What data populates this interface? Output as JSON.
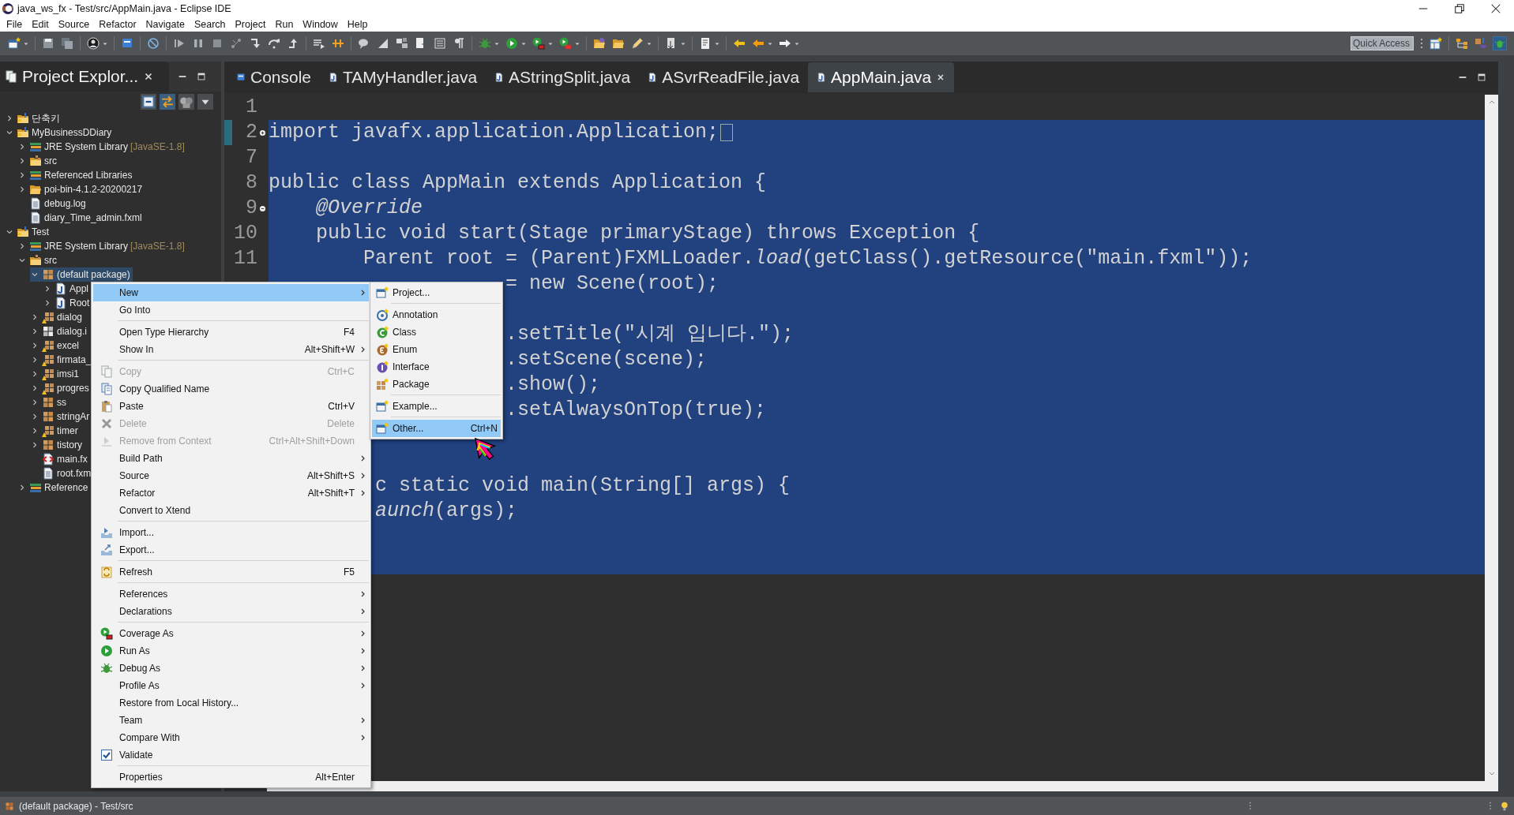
{
  "window": {
    "title": "java_ws_fx - Test/src/AppMain.java - Eclipse IDE"
  },
  "menu_bar": [
    "File",
    "Edit",
    "Source",
    "Refactor",
    "Navigate",
    "Search",
    "Project",
    "Run",
    "Window",
    "Help"
  ],
  "toolbar": {
    "quick_access": {
      "placeholder": "Quick Access"
    }
  },
  "project_explorer": {
    "title": "Project Explor...",
    "tree": [
      {
        "label": "단축키",
        "kind": "project",
        "expanded": false,
        "selected": false
      },
      {
        "label": "MyBusinessDDiary",
        "kind": "project",
        "expanded": true,
        "selected": false,
        "children": [
          {
            "label": "JRE System Library",
            "decoration": "[JavaSE-1.8]",
            "kind": "library",
            "expanded": false,
            "selected": false
          },
          {
            "label": "src",
            "kind": "source_folder",
            "expanded": false,
            "selected": false
          },
          {
            "label": "Referenced Libraries",
            "kind": "library",
            "expanded": false,
            "selected": false
          },
          {
            "label": "poi-bin-4.1.2-20200217",
            "kind": "folder",
            "expanded": false,
            "selected": false
          },
          {
            "label": "debug.log",
            "kind": "file",
            "selected": false
          },
          {
            "label": "diary_Time_admin.fxml",
            "kind": "file",
            "selected": false
          }
        ]
      },
      {
        "label": "Test",
        "kind": "project",
        "expanded": true,
        "selected": false,
        "children": [
          {
            "label": "JRE System Library",
            "decoration": "[JavaSE-1.8]",
            "kind": "library",
            "expanded": false,
            "selected": false
          },
          {
            "label": "src",
            "kind": "source_folder",
            "expanded": true,
            "selected": false,
            "children": [
              {
                "label": "(default package)",
                "kind": "package",
                "expanded": true,
                "selected": true,
                "children": [
                  {
                    "label": "Appl",
                    "kind": "java",
                    "expanded": false,
                    "selected": false
                  },
                  {
                    "label": "Root",
                    "kind": "java",
                    "expanded": false,
                    "selected": false
                  }
                ]
              },
              {
                "label": "dialog",
                "kind": "package_warning",
                "expanded": false,
                "selected": false
              },
              {
                "label": "dialog.i",
                "kind": "package_empty",
                "expanded": false,
                "selected": false
              },
              {
                "label": "excel",
                "kind": "package_warning",
                "expanded": false,
                "selected": false
              },
              {
                "label": "firmata_",
                "kind": "package_warning",
                "expanded": false,
                "selected": false
              },
              {
                "label": "imsi1",
                "kind": "package_warning",
                "expanded": false,
                "selected": false
              },
              {
                "label": "progres",
                "kind": "package_warning",
                "expanded": false,
                "selected": false
              },
              {
                "label": "ss",
                "kind": "package",
                "expanded": false,
                "selected": false
              },
              {
                "label": "stringAr",
                "kind": "package",
                "expanded": false,
                "selected": false
              },
              {
                "label": "timer",
                "kind": "package_warning",
                "expanded": false,
                "selected": false
              },
              {
                "label": "tistory",
                "kind": "package",
                "expanded": false,
                "selected": false
              },
              {
                "label": "main.fx",
                "kind": "fxml",
                "selected": false
              },
              {
                "label": "root.fxm",
                "kind": "file",
                "selected": false
              }
            ]
          },
          {
            "label": "Reference",
            "kind": "library",
            "expanded": false,
            "selected": false
          }
        ]
      }
    ]
  },
  "editor": {
    "tabs": [
      {
        "label": "Console",
        "selected": false
      },
      {
        "label": "TAMyHandler.java",
        "selected": false
      },
      {
        "label": "AStringSplit.java",
        "selected": false
      },
      {
        "label": "ASvrReadFile.java",
        "selected": false
      },
      {
        "label": "AppMain.java",
        "selected": true
      }
    ],
    "lines": [
      {
        "number": "1",
        "selected": false
      },
      {
        "number": "2",
        "text": "import javafx.application.Application;",
        "collapsed": true,
        "selected": true
      },
      {
        "number": "7",
        "selected": true
      },
      {
        "number": "8",
        "text": "public class AppMain extends Application {",
        "selected": true
      },
      {
        "number": "9",
        "text": "    @Override",
        "kind": "annotation",
        "collapsed": false,
        "selected": true
      },
      {
        "number": "10",
        "text": "    public void start(Stage primaryStage) throws Exception {",
        "overrides": true,
        "selected": true
      },
      {
        "number": "11",
        "text": "        Parent root = (Parent)FXMLLoader.*load*(getClass().getResource(\"main.fxml\"));",
        "selected": true
      },
      {
        "text": "                    = new Scene(root);",
        "selected": true
      },
      {
        "selected": true
      },
      {
        "text": "                    .setTitle(\"시계 입니다.\");",
        "selected": true
      },
      {
        "text": "                    .setScene(scene);",
        "selected": true
      },
      {
        "text": "                    .show();",
        "selected": true
      },
      {
        "text": "                    .setAlwaysOnTop(true);",
        "selected": true
      },
      {
        "selected": true
      },
      {
        "selected": true
      },
      {
        "text": "         c static void main(String[] args) {",
        "selected": true
      },
      {
        "text": "         *aunch*(args);",
        "selected": true
      },
      {
        "selected": true
      },
      {
        "selected": true
      }
    ]
  },
  "context_menu": {
    "items": [
      {
        "kind": "item",
        "label": "New",
        "submenu": true,
        "selected": true,
        "disabled": false
      },
      {
        "kind": "item",
        "label": "Go Into",
        "submenu": false,
        "selected": false,
        "disabled": false
      },
      {
        "kind": "separator"
      },
      {
        "kind": "item",
        "label": "Open Type Hierarchy",
        "shortcut": "F4",
        "submenu": false,
        "selected": false,
        "disabled": false
      },
      {
        "kind": "item",
        "label": "Show In",
        "shortcut": "Alt+Shift+W",
        "submenu": true,
        "selected": false,
        "disabled": false
      },
      {
        "kind": "separator"
      },
      {
        "kind": "item",
        "label": "Copy",
        "shortcut": "Ctrl+C",
        "submenu": false,
        "selected": false,
        "disabled": true
      },
      {
        "kind": "item",
        "label": "Copy Qualified Name",
        "submenu": false,
        "selected": false,
        "disabled": false
      },
      {
        "kind": "item",
        "label": "Paste",
        "shortcut": "Ctrl+V",
        "submenu": false,
        "selected": false,
        "disabled": false
      },
      {
        "kind": "item",
        "label": "Delete",
        "shortcut": "Delete",
        "submenu": false,
        "selected": false,
        "disabled": true
      },
      {
        "kind": "item",
        "label": "Remove from Context",
        "shortcut": "Ctrl+Alt+Shift+Down",
        "submenu": false,
        "selected": false,
        "disabled": true
      },
      {
        "kind": "item",
        "label": "Build Path",
        "submenu": true,
        "selected": false,
        "disabled": false
      },
      {
        "kind": "item",
        "label": "Source",
        "shortcut": "Alt+Shift+S",
        "submenu": true,
        "selected": false,
        "disabled": false
      },
      {
        "kind": "item",
        "label": "Refactor",
        "shortcut": "Alt+Shift+T",
        "submenu": true,
        "selected": false,
        "disabled": false
      },
      {
        "kind": "item",
        "label": "Convert to Xtend",
        "submenu": false,
        "selected": false,
        "disabled": false
      },
      {
        "kind": "separator"
      },
      {
        "kind": "item",
        "label": "Import...",
        "submenu": false,
        "selected": false,
        "disabled": false
      },
      {
        "kind": "item",
        "label": "Export...",
        "submenu": false,
        "selected": false,
        "disabled": false
      },
      {
        "kind": "separator"
      },
      {
        "kind": "item",
        "label": "Refresh",
        "shortcut": "F5",
        "submenu": false,
        "selected": false,
        "disabled": false
      },
      {
        "kind": "separator"
      },
      {
        "kind": "item",
        "label": "References",
        "submenu": true,
        "selected": false,
        "disabled": false
      },
      {
        "kind": "item",
        "label": "Declarations",
        "submenu": true,
        "selected": false,
        "disabled": false
      },
      {
        "kind": "separator"
      },
      {
        "kind": "item",
        "label": "Coverage As",
        "submenu": true,
        "selected": false,
        "disabled": false
      },
      {
        "kind": "item",
        "label": "Run As",
        "submenu": true,
        "selected": false,
        "disabled": false
      },
      {
        "kind": "item",
        "label": "Debug As",
        "submenu": true,
        "selected": false,
        "disabled": false
      },
      {
        "kind": "item",
        "label": "Profile As",
        "submenu": true,
        "selected": false,
        "disabled": false
      },
      {
        "kind": "item",
        "label": "Restore from Local History...",
        "submenu": false,
        "selected": false,
        "disabled": false
      },
      {
        "kind": "item",
        "label": "Team",
        "submenu": true,
        "selected": false,
        "disabled": false
      },
      {
        "kind": "item",
        "label": "Compare With",
        "submenu": true,
        "selected": false,
        "disabled": false
      },
      {
        "kind": "item",
        "label": "Validate",
        "submenu": false,
        "selected": false,
        "disabled": false
      },
      {
        "kind": "separator"
      },
      {
        "kind": "item",
        "label": "Properties",
        "shortcut": "Alt+Enter",
        "submenu": false,
        "selected": false,
        "disabled": false
      }
    ]
  },
  "new_submenu": {
    "items": [
      {
        "kind": "item",
        "label": "Project...",
        "selected": false
      },
      {
        "kind": "separator"
      },
      {
        "kind": "item",
        "label": "Annotation",
        "selected": false
      },
      {
        "kind": "item",
        "label": "Class",
        "selected": false
      },
      {
        "kind": "item",
        "label": "Enum",
        "selected": false
      },
      {
        "kind": "item",
        "label": "Interface",
        "selected": false
      },
      {
        "kind": "item",
        "label": "Package",
        "selected": false
      },
      {
        "kind": "separator"
      },
      {
        "kind": "item",
        "label": "Example...",
        "selected": false
      },
      {
        "kind": "separator"
      },
      {
        "kind": "item",
        "label": "Other...",
        "shortcut": "Ctrl+N",
        "selected": true
      }
    ]
  },
  "status_bar": {
    "text": "(default package) - Test/src"
  }
}
